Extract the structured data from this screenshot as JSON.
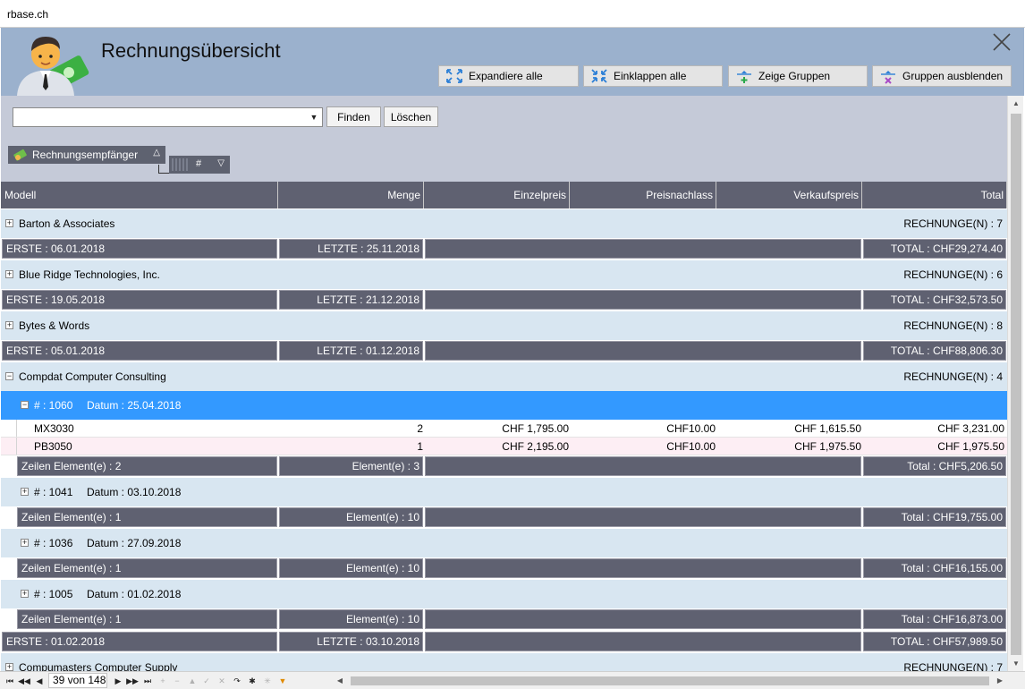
{
  "window": {
    "title": "rbase.ch"
  },
  "header": {
    "title": "Rechnungsübersicht",
    "buttons": {
      "expand": "Expandiere alle",
      "collapse": "Einklappen alle",
      "show_groups": "Zeige Gruppen",
      "hide_groups": "Gruppen ausblenden"
    }
  },
  "filter": {
    "search_value": "",
    "find_label": "Finden",
    "clear_label": "Löschen",
    "group_chip": "Rechnungsempfänger",
    "sub_chip": "#"
  },
  "columns": [
    "Modell",
    "Menge",
    "Einzelpreis",
    "Preisnachlass",
    "Verkaufspreis",
    "Total"
  ],
  "groups": [
    {
      "name": "Barton & Associates",
      "count": "RECHNUNGE(N) : 7",
      "first": "ERSTE : 06.01.2018",
      "last": "LETZTE : 25.11.2018",
      "total": "TOTAL : CHF29,274.40"
    },
    {
      "name": "Blue Ridge Technologies, Inc.",
      "count": "RECHNUNGE(N) : 6",
      "first": "ERSTE : 19.05.2018",
      "last": "LETZTE : 21.12.2018",
      "total": "TOTAL : CHF32,573.50"
    },
    {
      "name": "Bytes & Words",
      "count": "RECHNUNGE(N) : 8",
      "first": "ERSTE : 05.01.2018",
      "last": "LETZTE : 01.12.2018",
      "total": "TOTAL : CHF88,806.30"
    },
    {
      "name": "Compdat Computer Consulting",
      "count": "RECHNUNGE(N) : 4",
      "first": "ERSTE : 01.02.2018",
      "last": "LETZTE : 03.10.2018",
      "total": "TOTAL : CHF57,989.50"
    },
    {
      "name": "Compumasters Computer Supply",
      "count": "RECHNUNGE(N) : 7"
    }
  ],
  "invoices": [
    {
      "number": "# : 1060",
      "date": "Datum : 25.04.2018",
      "rows": [
        {
          "model": "MX3030",
          "qty": "2",
          "unit": "CHF 1,795.00",
          "discount": "CHF10.00",
          "sale": "CHF 1,615.50",
          "total": "CHF 3,231.00"
        },
        {
          "model": "PB3050",
          "qty": "1",
          "unit": "CHF 2,195.00",
          "discount": "CHF10.00",
          "sale": "CHF 1,975.50",
          "total": "CHF 1,975.50"
        }
      ],
      "lines": "Zeilen Element(e) : 2",
      "elements": "Element(e) : 3",
      "total": "Total : CHF5,206.50"
    },
    {
      "number": "# : 1041",
      "date": "Datum : 03.10.2018",
      "lines": "Zeilen Element(e) : 1",
      "elements": "Element(e) : 10",
      "total": "Total : CHF19,755.00"
    },
    {
      "number": "# : 1036",
      "date": "Datum : 27.09.2018",
      "lines": "Zeilen Element(e) : 1",
      "elements": "Element(e) : 10",
      "total": "Total : CHF16,155.00"
    },
    {
      "number": "# : 1005",
      "date": "Datum : 01.02.2018",
      "lines": "Zeilen Element(e) : 1",
      "elements": "Element(e) : 10",
      "total": "Total : CHF16,873.00"
    }
  ],
  "navigator": {
    "position": "39 von 148"
  },
  "colors": {
    "header_bg": "#9bb1cd",
    "filter_bg": "#c5cad8",
    "dark_cell": "#5f6171",
    "group_row": "#d8e6f1",
    "selected": "#3399ff",
    "alt_row": "#fdeef4"
  }
}
